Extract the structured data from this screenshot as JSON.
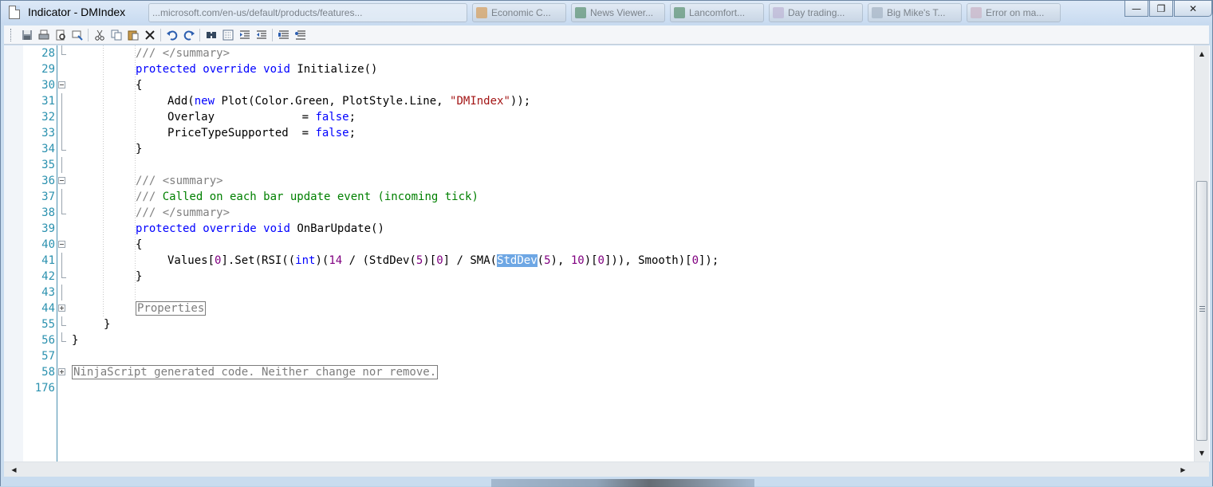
{
  "window": {
    "title": "Indicator - DMIndex",
    "background_tasks": [
      "Economic C...",
      "News Viewer...",
      "Lancomfort...",
      "Day trading...",
      "Big Mike's T...",
      "Error on ma..."
    ],
    "address_fragment": "...microsoft.com/en-us/default/products/features...",
    "controls": {
      "minimize": "—",
      "maximize": "❐",
      "close": "✕"
    }
  },
  "toolbar": {
    "items": [
      "save-icon",
      "print-icon",
      "print-preview-icon",
      "export-icon",
      "cut-icon",
      "copy-icon",
      "paste-icon",
      "delete-icon",
      "undo-icon",
      "redo-icon",
      "find-icon",
      "find-next-icon",
      "indent-icon",
      "outdent-icon",
      "comment-icon",
      "uncomment-icon"
    ]
  },
  "editor": {
    "lines": [
      {
        "n": "28",
        "fold": "end",
        "indent": 2,
        "tokens": [
          {
            "t": "/// </summary>",
            "c": "xt"
          }
        ]
      },
      {
        "n": "29",
        "fold": "none",
        "indent": 2,
        "tokens": [
          {
            "t": "protected",
            "c": "kw"
          },
          {
            "t": " "
          },
          {
            "t": "override",
            "c": "kw"
          },
          {
            "t": " "
          },
          {
            "t": "void",
            "c": "kw"
          },
          {
            "t": " Initialize()"
          }
        ]
      },
      {
        "n": "30",
        "fold": "minus",
        "indent": 2,
        "tokens": [
          {
            "t": "{"
          }
        ]
      },
      {
        "n": "31",
        "fold": "line",
        "indent": 3,
        "tokens": [
          {
            "t": "Add("
          },
          {
            "t": "new",
            "c": "kw"
          },
          {
            "t": " Plot(Color.Green, PlotStyle.Line, "
          },
          {
            "t": "\"DMIndex\"",
            "c": "str"
          },
          {
            "t": "));"
          }
        ]
      },
      {
        "n": "32",
        "fold": "line",
        "indent": 3,
        "tokens": [
          {
            "t": "Overlay             = "
          },
          {
            "t": "false",
            "c": "kw"
          },
          {
            "t": ";"
          }
        ]
      },
      {
        "n": "33",
        "fold": "line",
        "indent": 3,
        "tokens": [
          {
            "t": "PriceTypeSupported  = "
          },
          {
            "t": "false",
            "c": "kw"
          },
          {
            "t": ";"
          }
        ]
      },
      {
        "n": "34",
        "fold": "end",
        "indent": 2,
        "tokens": [
          {
            "t": "}"
          }
        ]
      },
      {
        "n": "35",
        "fold": "line",
        "indent": 0,
        "tokens": []
      },
      {
        "n": "36",
        "fold": "minus",
        "indent": 2,
        "tokens": [
          {
            "t": "/// ",
            "c": "xt"
          },
          {
            "t": "<summary>",
            "c": "xt"
          }
        ]
      },
      {
        "n": "37",
        "fold": "line",
        "indent": 2,
        "tokens": [
          {
            "t": "/// ",
            "c": "xt"
          },
          {
            "t": "Called on each bar update event (incoming tick)",
            "c": "cm"
          }
        ]
      },
      {
        "n": "38",
        "fold": "end",
        "indent": 2,
        "tokens": [
          {
            "t": "/// </summary>",
            "c": "xt"
          }
        ]
      },
      {
        "n": "39",
        "fold": "none",
        "indent": 2,
        "tokens": [
          {
            "t": "protected",
            "c": "kw"
          },
          {
            "t": " "
          },
          {
            "t": "override",
            "c": "kw"
          },
          {
            "t": " "
          },
          {
            "t": "void",
            "c": "kw"
          },
          {
            "t": " OnBarUpdate()"
          }
        ]
      },
      {
        "n": "40",
        "fold": "minus",
        "indent": 2,
        "tokens": [
          {
            "t": "{"
          }
        ]
      },
      {
        "n": "41",
        "fold": "line",
        "indent": 3,
        "tokens": [
          {
            "t": "Values["
          },
          {
            "t": "0",
            "c": "num"
          },
          {
            "t": "].Set(RSI(("
          },
          {
            "t": "int",
            "c": "kw"
          },
          {
            "t": ")("
          },
          {
            "t": "14",
            "c": "num"
          },
          {
            "t": " / (StdDev("
          },
          {
            "t": "5",
            "c": "num"
          },
          {
            "t": ")["
          },
          {
            "t": "0",
            "c": "num"
          },
          {
            "t": "] / SMA("
          },
          {
            "t": "StdDev",
            "c": "sel"
          },
          {
            "t": "("
          },
          {
            "t": "5",
            "c": "num"
          },
          {
            "t": "), "
          },
          {
            "t": "10",
            "c": "num"
          },
          {
            "t": ")["
          },
          {
            "t": "0",
            "c": "num"
          },
          {
            "t": "])), Smooth)["
          },
          {
            "t": "0",
            "c": "num"
          },
          {
            "t": "]);"
          }
        ]
      },
      {
        "n": "42",
        "fold": "end",
        "indent": 2,
        "tokens": [
          {
            "t": "}"
          }
        ]
      },
      {
        "n": "43",
        "fold": "line",
        "indent": 0,
        "tokens": []
      },
      {
        "n": "44",
        "fold": "plus",
        "indent": 2,
        "tokens": [
          {
            "t": "Properties",
            "c": "collapsed"
          }
        ]
      },
      {
        "n": "55",
        "fold": "end",
        "indent": 1,
        "tokens": [
          {
            "t": "}"
          }
        ]
      },
      {
        "n": "56",
        "fold": "end",
        "indent": 0,
        "tokens": [
          {
            "t": "}"
          }
        ]
      },
      {
        "n": "57",
        "fold": "none",
        "indent": 0,
        "tokens": []
      },
      {
        "n": "58",
        "fold": "plus",
        "indent": 0,
        "tokens": [
          {
            "t": "NinjaScript generated code. Neither change nor remove.",
            "c": "collapsed"
          }
        ]
      },
      {
        "n": "176",
        "fold": "none",
        "indent": 0,
        "tokens": []
      }
    ]
  },
  "scroll": {
    "up": "▲",
    "down": "▼",
    "left": "◀",
    "right": "▶"
  }
}
